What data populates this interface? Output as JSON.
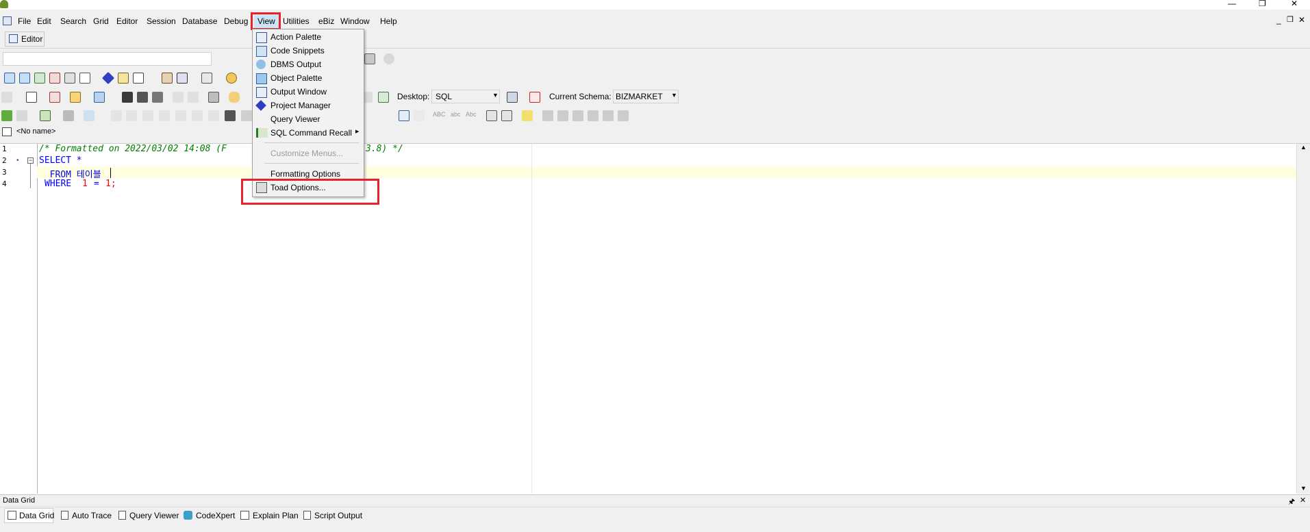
{
  "menubar": {
    "items": [
      {
        "label": "File"
      },
      {
        "label": "Edit"
      },
      {
        "label": "Search"
      },
      {
        "label": "Grid"
      },
      {
        "label": "Editor"
      },
      {
        "label": "Session"
      },
      {
        "label": "Database"
      },
      {
        "label": "Debug"
      },
      {
        "label": "View"
      },
      {
        "label": "Utilities"
      },
      {
        "label": "eBiz"
      },
      {
        "label": "Window"
      },
      {
        "label": "Help"
      }
    ]
  },
  "window_controls": {
    "minimize": "—",
    "restore": "❐",
    "close": "✕",
    "mdi_min": "_",
    "mdi_restore": "❐",
    "mdi_close": "✕"
  },
  "editor_tab": {
    "label": "Editor"
  },
  "toolbar": {
    "desktop_label": "Desktop:",
    "desktop_value": "SQL",
    "schema_label": "Current Schema:",
    "schema_value": "BIZMARKET",
    "case_labels": [
      "ABC",
      "abc",
      "Abc"
    ]
  },
  "doc_tab": {
    "label": "<No name>"
  },
  "editor": {
    "line_numbers": [
      "1",
      "2",
      "3",
      "4"
    ],
    "lines": [
      "/* Formatted on 2022/03/02 14:08 (F",
      "SELECT *",
      "  FROM 테이블",
      " WHERE 1 = 1;"
    ],
    "comment_tail": "3.8) */",
    "where_keyword": "WHERE",
    "where_num1": "1",
    "where_eq": "=",
    "where_num2": "1;"
  },
  "view_menu": {
    "items": [
      {
        "label": "Action Palette",
        "accel": "A"
      },
      {
        "label": "Code Snippets",
        "accel": "C"
      },
      {
        "label": "DBMS Output",
        "accel": "D"
      },
      {
        "label": "Object Palette",
        "accel": "b"
      },
      {
        "label": "Output Window",
        "accel": "O"
      },
      {
        "label": "Project Manager",
        "accel": "P"
      },
      {
        "label": "Query Viewer",
        "accel": "Q"
      },
      {
        "label": "SQL Command Recall",
        "accel": "S"
      },
      {
        "label": "Customize Menus...",
        "accel": "M"
      },
      {
        "label": "Formatting Options",
        "accel": ""
      },
      {
        "label": "Toad Options...",
        "accel": "T"
      }
    ],
    "submenu_arrow": "▶"
  },
  "data_grid": {
    "title": "Data Grid",
    "pin": "🖈",
    "close": "✕",
    "tabs": [
      {
        "label": "Data Grid"
      },
      {
        "label": "Auto Trace"
      },
      {
        "label": "Query Viewer"
      },
      {
        "label": "CodeXpert"
      },
      {
        "label": "Explain Plan"
      },
      {
        "label": "Script Output"
      }
    ]
  },
  "colors": {
    "highlight": "#e8212b",
    "comment": "#008000",
    "keyword": "#0000ff",
    "number": "#ff0000",
    "current_line": "#ffffe0"
  }
}
